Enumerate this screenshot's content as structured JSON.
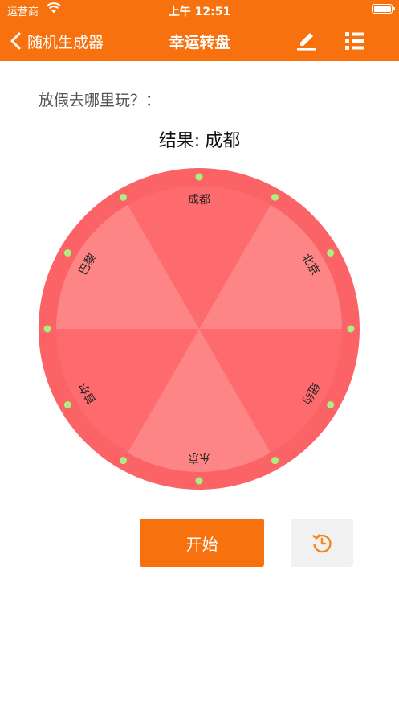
{
  "status_bar": {
    "carrier": "运营商",
    "time": "上午 12:51",
    "icons": [
      "wifi-icon",
      "battery-icon"
    ]
  },
  "nav": {
    "back_label": "随机生成器",
    "title": "幸运转盘",
    "icons": [
      "chevron-left-icon",
      "edit-icon",
      "list-icon"
    ]
  },
  "question": "放假去哪里玩？：",
  "result": {
    "label": "结果:",
    "value": "成都"
  },
  "wheel": {
    "segments": [
      "成都",
      "北京",
      "纽约",
      "东京",
      "首尔",
      "巴黎"
    ],
    "colors": [
      "#FD6B6E",
      "#FD8585"
    ],
    "rim_color": "#FB6366",
    "dot_color": "#A8F07F"
  },
  "buttons": {
    "start": "开始",
    "history_icon": "history-icon"
  },
  "colors": {
    "accent": "#F7720F"
  }
}
